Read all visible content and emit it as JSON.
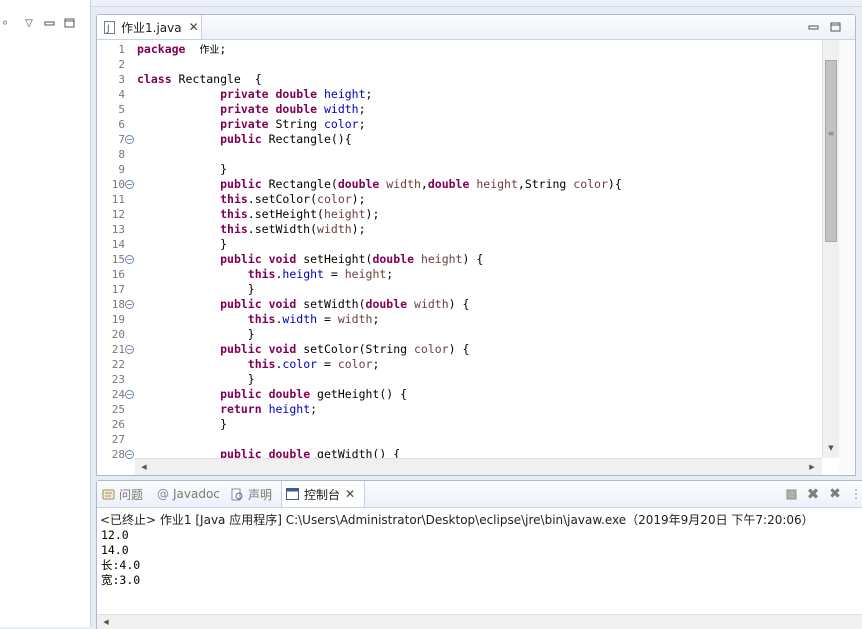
{
  "editor": {
    "tab_label": "作业1.java",
    "lines": [
      {
        "n": "1",
        "seg": [
          [
            "kw",
            "package"
          ],
          [
            "",
            "  "
          ],
          [
            "cn",
            "作业"
          ],
          [
            "",
            ";"
          ]
        ]
      },
      {
        "n": "2",
        "seg": []
      },
      {
        "n": "3",
        "seg": [
          [
            "kw",
            "class"
          ],
          [
            "",
            " Rectangle  {"
          ]
        ]
      },
      {
        "n": "4",
        "seg": [
          [
            "",
            "            "
          ],
          [
            "kw",
            "private"
          ],
          [
            "",
            " "
          ],
          [
            "kw",
            "double"
          ],
          [
            "",
            " "
          ],
          [
            "fld",
            "height"
          ],
          [
            "",
            ";"
          ]
        ]
      },
      {
        "n": "5",
        "seg": [
          [
            "",
            "            "
          ],
          [
            "kw",
            "private"
          ],
          [
            "",
            " "
          ],
          [
            "kw",
            "double"
          ],
          [
            "",
            " "
          ],
          [
            "fld",
            "width"
          ],
          [
            "",
            ";"
          ]
        ]
      },
      {
        "n": "6",
        "seg": [
          [
            "",
            "            "
          ],
          [
            "kw",
            "private"
          ],
          [
            "",
            " String "
          ],
          [
            "fld",
            "color"
          ],
          [
            "",
            ";"
          ]
        ]
      },
      {
        "n": "7",
        "fold": true,
        "seg": [
          [
            "",
            "            "
          ],
          [
            "kw",
            "public"
          ],
          [
            "",
            " Rectangle(){"
          ]
        ]
      },
      {
        "n": "8",
        "seg": []
      },
      {
        "n": "9",
        "seg": [
          [
            "",
            "            }"
          ]
        ]
      },
      {
        "n": "10",
        "fold": true,
        "seg": [
          [
            "",
            "            "
          ],
          [
            "kw",
            "public"
          ],
          [
            "",
            " Rectangle("
          ],
          [
            "kw",
            "double"
          ],
          [
            "",
            " "
          ],
          [
            "par",
            "width"
          ],
          [
            "",
            ","
          ],
          [
            "kw",
            "double"
          ],
          [
            "",
            " "
          ],
          [
            "par",
            "height"
          ],
          [
            "",
            ",String "
          ],
          [
            "par",
            "color"
          ],
          [
            "",
            "){"
          ]
        ]
      },
      {
        "n": "11",
        "seg": [
          [
            "",
            "            "
          ],
          [
            "kw",
            "this"
          ],
          [
            "",
            ".setColor("
          ],
          [
            "par",
            "color"
          ],
          [
            "",
            ");"
          ]
        ]
      },
      {
        "n": "12",
        "seg": [
          [
            "",
            "            "
          ],
          [
            "kw",
            "this"
          ],
          [
            "",
            ".setHeight("
          ],
          [
            "par",
            "height"
          ],
          [
            "",
            ");"
          ]
        ]
      },
      {
        "n": "13",
        "seg": [
          [
            "",
            "            "
          ],
          [
            "kw",
            "this"
          ],
          [
            "",
            ".setWidth("
          ],
          [
            "par",
            "width"
          ],
          [
            "",
            ");"
          ]
        ]
      },
      {
        "n": "14",
        "seg": [
          [
            "",
            "            }"
          ]
        ]
      },
      {
        "n": "15",
        "fold": true,
        "seg": [
          [
            "",
            "            "
          ],
          [
            "kw",
            "public"
          ],
          [
            "",
            " "
          ],
          [
            "kw",
            "void"
          ],
          [
            "",
            " setHeight("
          ],
          [
            "kw",
            "double"
          ],
          [
            "",
            " "
          ],
          [
            "par",
            "height"
          ],
          [
            "",
            ") {"
          ]
        ]
      },
      {
        "n": "16",
        "seg": [
          [
            "",
            "                "
          ],
          [
            "kw",
            "this"
          ],
          [
            "",
            "."
          ],
          [
            "fld",
            "height"
          ],
          [
            "",
            " = "
          ],
          [
            "par",
            "height"
          ],
          [
            "",
            ";"
          ]
        ]
      },
      {
        "n": "17",
        "seg": [
          [
            "",
            "                }"
          ]
        ]
      },
      {
        "n": "18",
        "fold": true,
        "seg": [
          [
            "",
            "            "
          ],
          [
            "kw",
            "public"
          ],
          [
            "",
            " "
          ],
          [
            "kw",
            "void"
          ],
          [
            "",
            " setWidth("
          ],
          [
            "kw",
            "double"
          ],
          [
            "",
            " "
          ],
          [
            "par",
            "width"
          ],
          [
            "",
            ") {"
          ]
        ]
      },
      {
        "n": "19",
        "seg": [
          [
            "",
            "                "
          ],
          [
            "kw",
            "this"
          ],
          [
            "",
            "."
          ],
          [
            "fld",
            "width"
          ],
          [
            "",
            " = "
          ],
          [
            "par",
            "width"
          ],
          [
            "",
            ";"
          ]
        ]
      },
      {
        "n": "20",
        "seg": [
          [
            "",
            "                }"
          ]
        ]
      },
      {
        "n": "21",
        "fold": true,
        "seg": [
          [
            "",
            "            "
          ],
          [
            "kw",
            "public"
          ],
          [
            "",
            " "
          ],
          [
            "kw",
            "void"
          ],
          [
            "",
            " setColor(String "
          ],
          [
            "par",
            "color"
          ],
          [
            "",
            ") {"
          ]
        ]
      },
      {
        "n": "22",
        "seg": [
          [
            "",
            "                "
          ],
          [
            "kw",
            "this"
          ],
          [
            "",
            "."
          ],
          [
            "fld",
            "color"
          ],
          [
            "",
            " = "
          ],
          [
            "par",
            "color"
          ],
          [
            "",
            ";"
          ]
        ]
      },
      {
        "n": "23",
        "seg": [
          [
            "",
            "                }"
          ]
        ]
      },
      {
        "n": "24",
        "fold": true,
        "seg": [
          [
            "",
            "            "
          ],
          [
            "kw",
            "public"
          ],
          [
            "",
            " "
          ],
          [
            "kw",
            "double"
          ],
          [
            "",
            " getHeight() {"
          ]
        ]
      },
      {
        "n": "25",
        "seg": [
          [
            "",
            "            "
          ],
          [
            "kw",
            "return"
          ],
          [
            "",
            " "
          ],
          [
            "fld",
            "height"
          ],
          [
            "",
            ";"
          ]
        ]
      },
      {
        "n": "26",
        "seg": [
          [
            "",
            "            }"
          ]
        ]
      },
      {
        "n": "27",
        "seg": []
      },
      {
        "n": "28",
        "fold": true,
        "seg": [
          [
            "",
            "            "
          ],
          [
            "kw",
            "public"
          ],
          [
            "",
            " "
          ],
          [
            "kw",
            "double"
          ],
          [
            "",
            " getWidth() {"
          ]
        ]
      }
    ]
  },
  "console": {
    "tabs": [
      {
        "label": "问题",
        "icon": "problems-icon",
        "active": false
      },
      {
        "label": "Javadoc",
        "icon": "javadoc-icon",
        "active": false
      },
      {
        "label": "声明",
        "icon": "declaration-icon",
        "active": false
      },
      {
        "label": "控制台",
        "icon": "console-icon",
        "active": true
      }
    ],
    "info": "<已终止> 作业1 [Java 应用程序] C:\\Users\\Administrator\\Desktop\\eclipse\\jre\\bin\\javaw.exe（2019年9月20日 下午7:20:06）",
    "output": [
      "12.0",
      "14.0",
      "长:4.0",
      "宽:3.0"
    ]
  },
  "colors": {
    "keyword": "#7f0055",
    "field": "#0000c0",
    "parameter": "#6a3e3e",
    "tab_border": "#a9b9d1"
  }
}
